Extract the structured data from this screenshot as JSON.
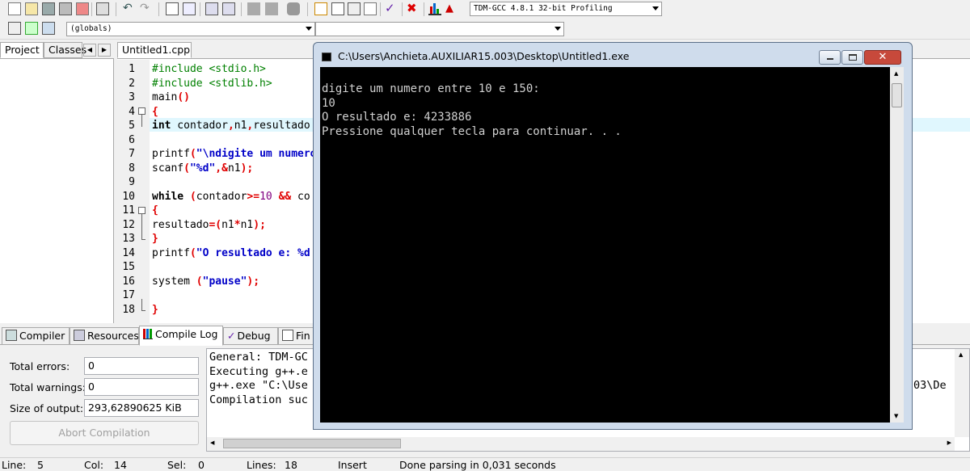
{
  "toolbar": {
    "compiler_select": "TDM-GCC 4.8.1 32-bit Profiling",
    "scope_select": "(globals)",
    "member_select": ""
  },
  "left_panel": {
    "tabs": [
      "Project",
      "Classes"
    ]
  },
  "editor": {
    "tab_label": "Untitled1.cpp",
    "line_numbers": [
      "1",
      "2",
      "3",
      "4",
      "5",
      "6",
      "7",
      "8",
      "9",
      "10",
      "11",
      "12",
      "13",
      "14",
      "15",
      "16",
      "17",
      "18"
    ]
  },
  "bottom_tabs": {
    "compiler": "Compiler",
    "resources": "Resources",
    "compile_log": "Compile Log",
    "debug": "Debug",
    "find": "Fin"
  },
  "compile_stats": {
    "total_errors_label": "Total errors:",
    "total_errors": "0",
    "total_warnings_label": "Total warnings:",
    "total_warnings": "0",
    "size_label": "Size of output:",
    "size": "293,62890625 KiB",
    "abort_label": "Abort Compilation"
  },
  "compile_log": {
    "line1": "General: TDM-GC",
    "line2": "Executing g++.e",
    "line3": "g++.exe \"C:\\Use",
    "line3_tail": "03\\De",
    "line4": "Compilation suc"
  },
  "console": {
    "title": "C:\\Users\\Anchieta.AUXILIAR15.003\\Desktop\\Untitled1.exe",
    "line1": "digite um numero entre 10 e 150:",
    "line2": "10",
    "line3": "O resultado e: 4233886",
    "line4": "Pressione qualquer tecla para continuar. . ."
  },
  "statusbar": {
    "line_label": "Line:",
    "line_value": "5",
    "col_label": "Col:",
    "col_value": "14",
    "sel_label": "Sel:",
    "sel_value": "0",
    "lines_label": "Lines:",
    "lines_value": "18",
    "mode": "Insert",
    "message": "Done parsing in 0,031 seconds"
  },
  "colors": {
    "current_line": "#e0f7fe",
    "console_bg": "#000000",
    "close_button": "#c7493b"
  }
}
